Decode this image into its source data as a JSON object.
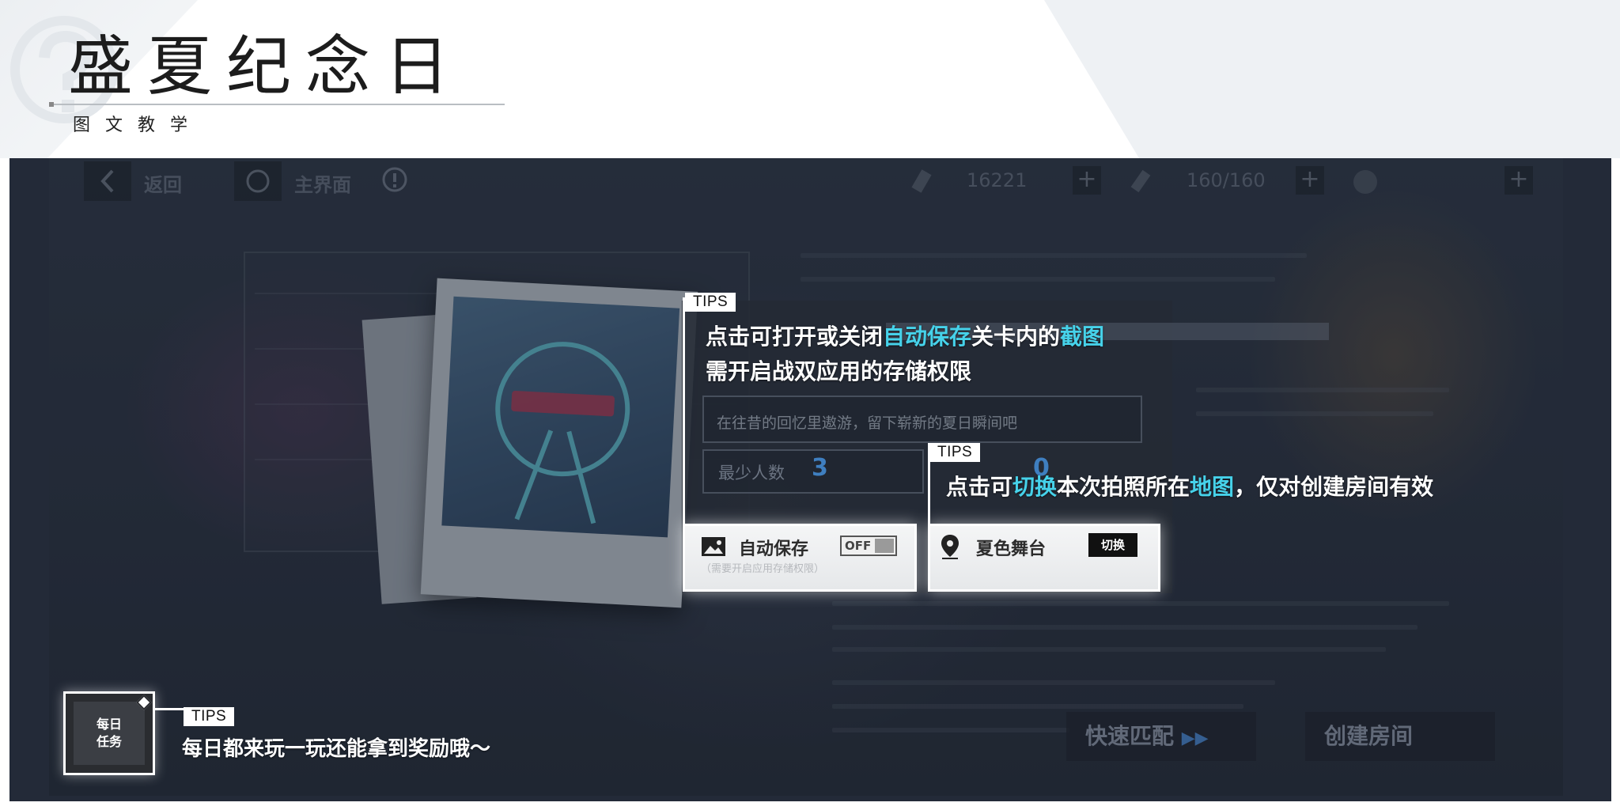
{
  "header": {
    "title": "盛夏纪念日",
    "subtitle": "图文教学"
  },
  "screenshot": {
    "topbar": {
      "back_label": "返回",
      "home_label": "主界面",
      "currency1": "16221",
      "stamina": "160/160"
    },
    "form": {
      "placeholder_text": "在往昔的回忆里遨游，留下崭新的夏日瞬间吧",
      "min_players_label": "最少人数",
      "min_players_value": "3",
      "second_value": "0"
    },
    "autosave": {
      "label": "自动保存",
      "sublabel": "（需要开启应用存储权限）",
      "toggle": "OFF"
    },
    "stage": {
      "label": "夏色舞台",
      "switch_label": "切换"
    },
    "quick_match_label": "快速匹配",
    "create_room_label": "创建房间",
    "daily_task_label_line1": "每日",
    "daily_task_label_line2": "任务"
  },
  "tips": {
    "tag": "TIPS",
    "tip1_line1_a": "点击可打开或关闭",
    "tip1_line1_hl1": "自动保存",
    "tip1_line1_b": "关卡内的",
    "tip1_line1_hl2": "截图",
    "tip1_line2": "需开启战双应用的存储权限",
    "tip2_a": "点击可",
    "tip2_hl1": "切换",
    "tip2_b": "本次拍照所在",
    "tip2_hl2": "地图",
    "tip2_c": "，仅对创建房间有效",
    "tip3": "每日都来玩一玩还能拿到奖励哦～"
  },
  "colors": {
    "highlight": "#46d2ea",
    "panel_bg": "#2b3442",
    "number_blue": "#3f7fc0"
  }
}
